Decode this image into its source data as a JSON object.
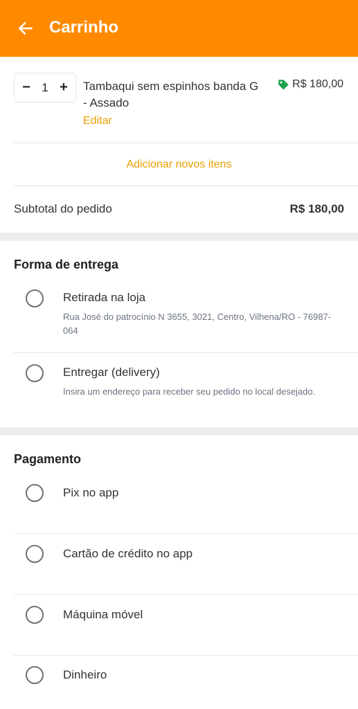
{
  "header": {
    "title": "Carrinho"
  },
  "cart": {
    "item": {
      "quantity": "1",
      "minus": "−",
      "plus": "+",
      "name": "Tambaqui sem espinhos banda G - Assado",
      "edit": "Editar",
      "price": "R$ 180,00"
    },
    "add_items": "Adicionar novos itens",
    "subtotal_label": "Subtotal do pedido",
    "subtotal_value": "R$ 180,00"
  },
  "delivery": {
    "title": "Forma de entrega",
    "options": [
      {
        "label": "Retirada na loja",
        "sub": "Rua José do patrocínio N 3655, 3021, Centro, Vilhena/RO - 76987-064"
      },
      {
        "label": "Entregar (delivery)",
        "sub": "Insira um endereço para receber seu pedido no local desejado."
      }
    ]
  },
  "payment": {
    "title": "Pagamento",
    "options": [
      {
        "label": "Pix no app"
      },
      {
        "label": "Cartão de crédito no app"
      },
      {
        "label": "Máquina móvel"
      },
      {
        "label": "Dinheiro"
      }
    ]
  },
  "colors": {
    "accent": "#ff8a00",
    "link": "#e8a000",
    "tag": "#1aa34a"
  },
  "icons": {
    "back": "arrow-left-icon",
    "tag": "price-tag-icon"
  }
}
